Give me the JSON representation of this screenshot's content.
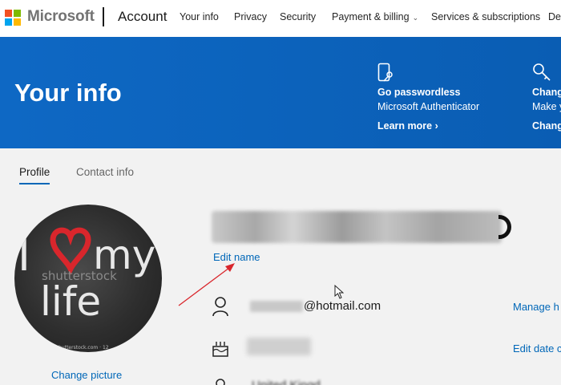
{
  "nav": {
    "brand": "Microsoft",
    "account": "Account",
    "links": [
      "Your info",
      "Privacy",
      "Security",
      "Payment & billing",
      "Services & subscriptions",
      "De"
    ],
    "logo_colors": [
      "#f25022",
      "#7fba00",
      "#00a4ef",
      "#ffb900"
    ]
  },
  "banner": {
    "title": "Your info",
    "promos": [
      {
        "icon": "phone-key-icon",
        "title": "Go passwordless",
        "subtitle": "Microsoft Authenticator",
        "link": "Learn more"
      },
      {
        "icon": "key-icon",
        "title": "Chang",
        "subtitle": "Make y",
        "link": "Chang"
      }
    ]
  },
  "tabs": {
    "profile": "Profile",
    "contact": "Contact info"
  },
  "profile": {
    "avatar_text_line1": "I",
    "avatar_text_line1b": "my",
    "avatar_text_line2": "life",
    "avatar_watermark": "shutterstock",
    "avatar_caption": "shutterstock.com · 12",
    "change_picture": "Change picture",
    "edit_name": "Edit name",
    "email_suffix": "@hotmail.com",
    "region_text": "United Kingd",
    "manage_link": "Manage h",
    "edit_date_link": "Edit date c",
    "region_link": "·"
  },
  "colors": {
    "accent": "#0067b8",
    "banner": "#0a60b8",
    "heart": "#d9262c",
    "arrow": "#d9262c"
  }
}
